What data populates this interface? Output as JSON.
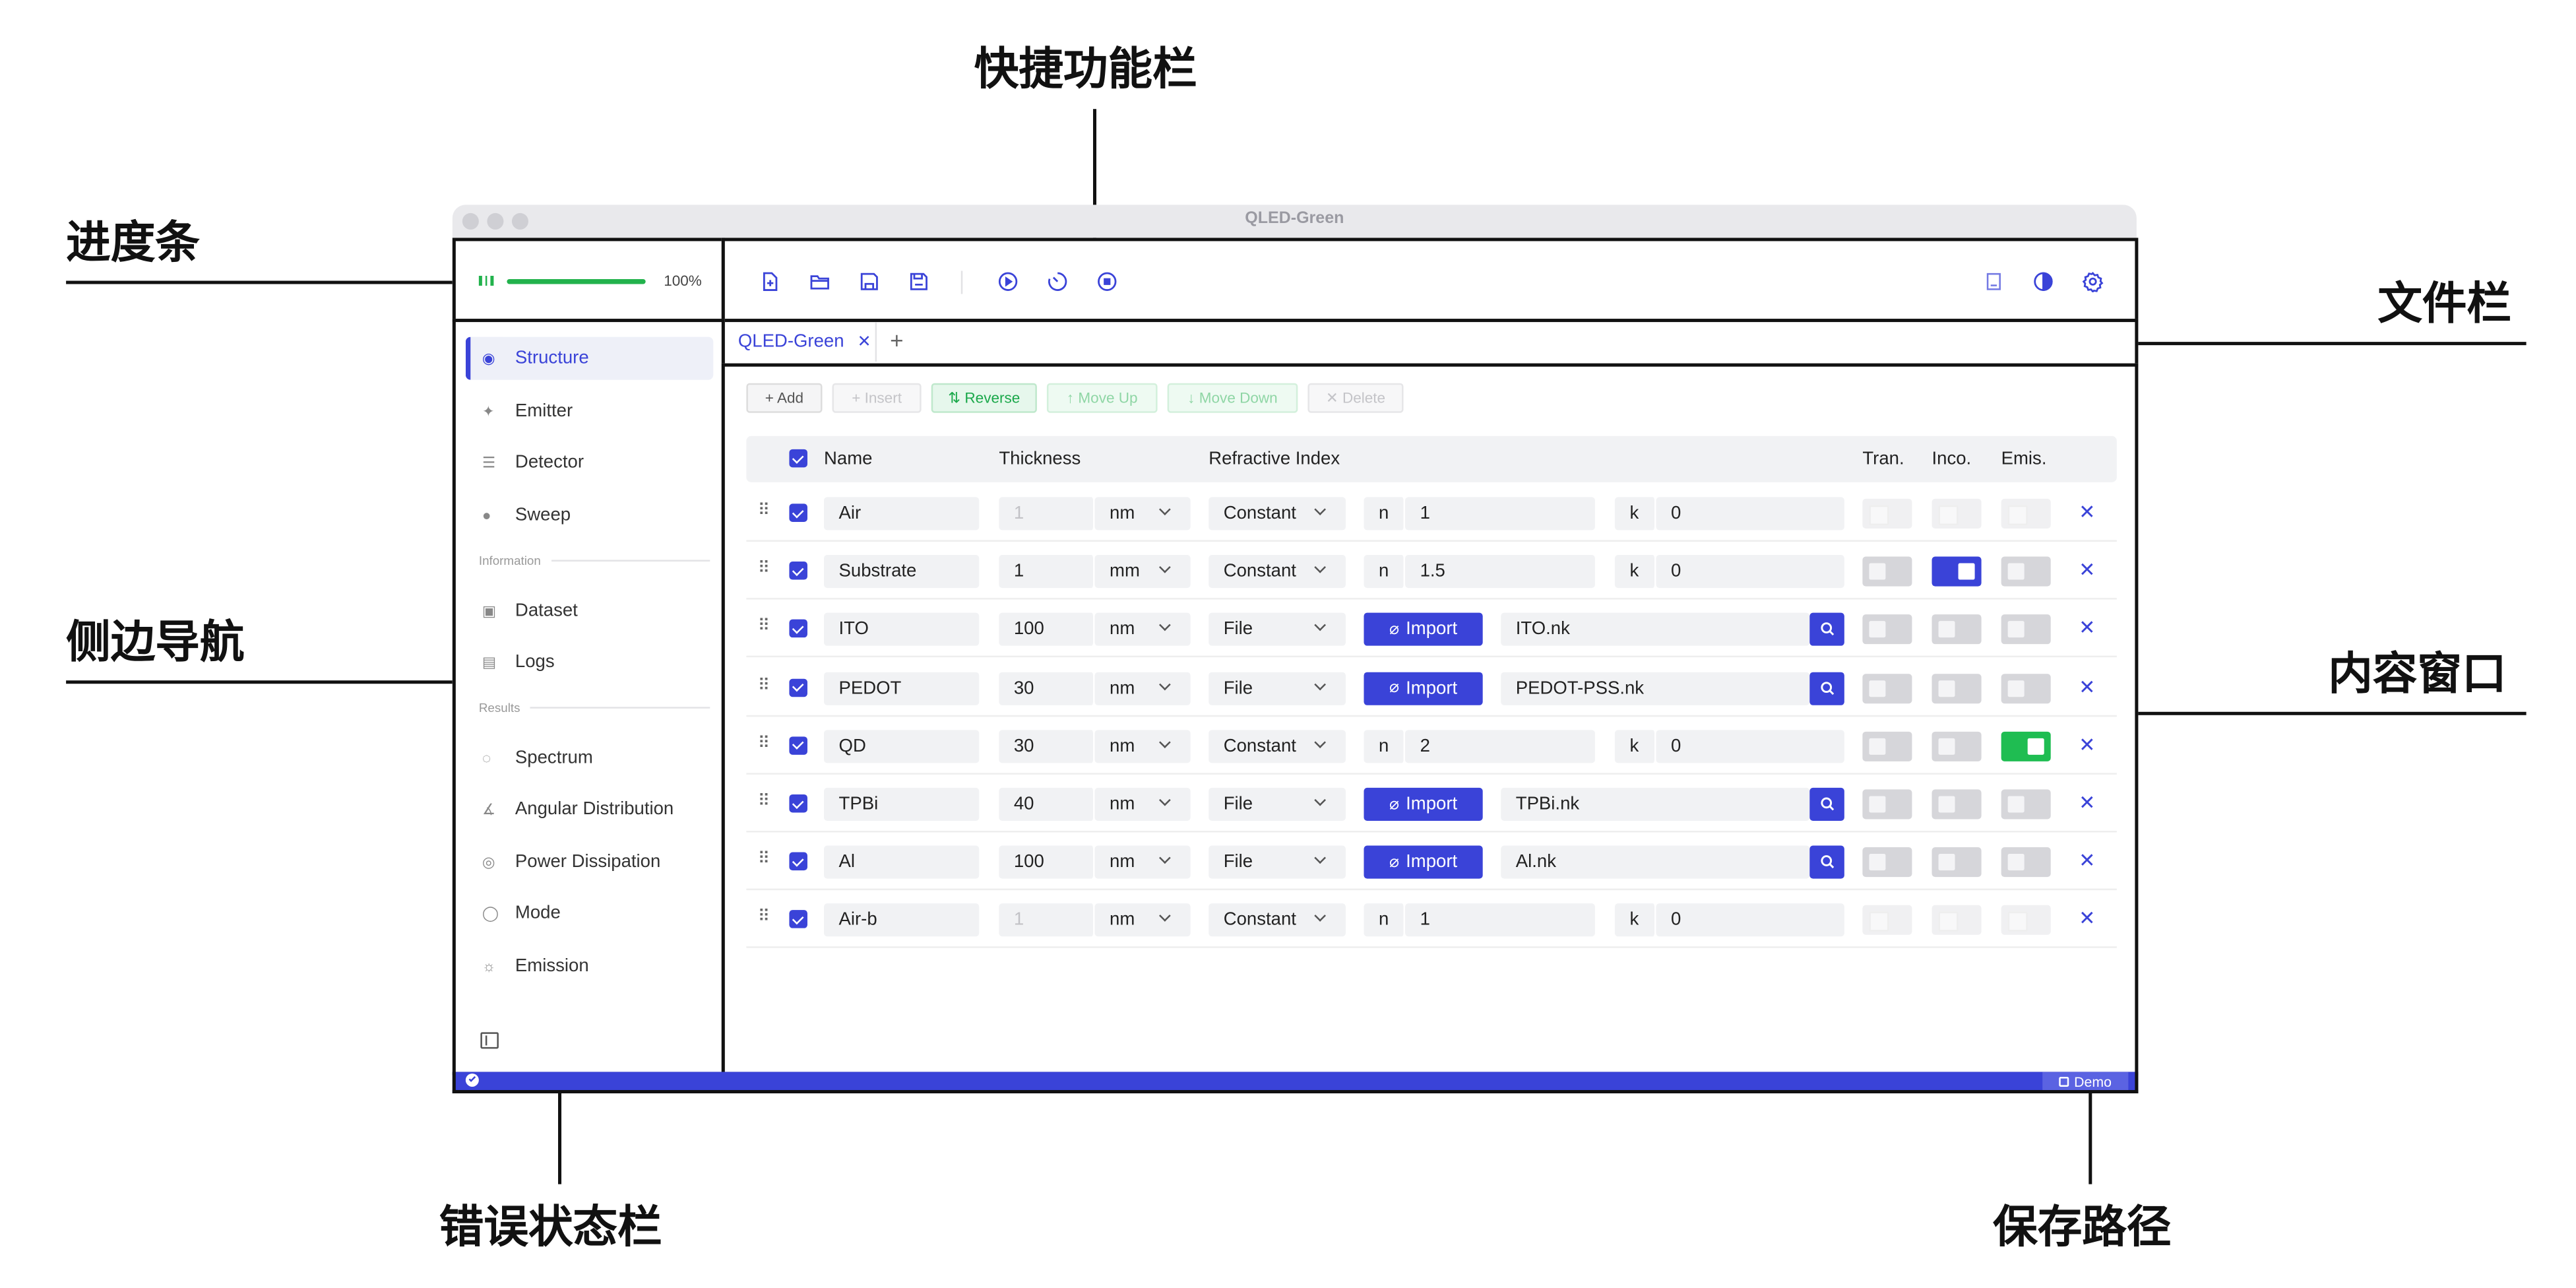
{
  "callouts": {
    "quick_toolbar": "快捷功能栏",
    "progress": "进度条",
    "file_bar": "文件栏",
    "sidebar": "侧边导航",
    "content": "内容窗口",
    "error_status": "错误状态栏",
    "save_path": "保存路径"
  },
  "window": {
    "title": "QLED-Green"
  },
  "progress": {
    "label": "100%",
    "value": 1.0,
    "color": "#22b24c"
  },
  "toolbar": {
    "left_icons": [
      "new-file-icon",
      "open-folder-icon",
      "save-icon",
      "save-as-icon"
    ],
    "run_icons": [
      "play-icon",
      "timer-icon",
      "stop-icon"
    ],
    "right_icons": [
      "book-icon",
      "theme-icon",
      "settings-icon"
    ]
  },
  "tabs": [
    {
      "label": "QLED-Green",
      "close": "✕"
    }
  ],
  "tab_add": "+",
  "sidebar": {
    "items": [
      {
        "label": "Structure",
        "icon": "database-icon",
        "active": true
      },
      {
        "label": "Emitter",
        "icon": "sparkle-icon"
      },
      {
        "label": "Detector",
        "icon": "sliders-icon"
      },
      {
        "label": "Sweep",
        "icon": "sweep-icon"
      }
    ],
    "information_label": "Information",
    "information": [
      {
        "label": "Dataset",
        "icon": "dataset-icon"
      },
      {
        "label": "Logs",
        "icon": "printer-icon"
      }
    ],
    "results_label": "Results",
    "results": [
      {
        "label": "Spectrum",
        "icon": "spectrum-icon"
      },
      {
        "label": "Angular Distribution",
        "icon": "angle-icon"
      },
      {
        "label": "Power Dissipation",
        "icon": "gauge-icon"
      },
      {
        "label": "Mode",
        "icon": "circle-icon"
      },
      {
        "label": "Emission",
        "icon": "sun-icon"
      }
    ],
    "collapse_icon": "collapse-sidebar-icon"
  },
  "actions": {
    "add": "+ Add",
    "insert": "+ Insert",
    "reverse": "⇅ Reverse",
    "move_up": "↑ Move Up",
    "move_down": "↓ Move Down",
    "delete": "✕ Delete"
  },
  "table": {
    "headers": {
      "name": "Name",
      "thickness": "Thickness",
      "ri": "Refractive Index",
      "tran": "Tran.",
      "inco": "Inco.",
      "emis": "Emis."
    },
    "import_label": "Import",
    "n_label": "n",
    "k_label": "k",
    "rows": [
      {
        "name": "Air",
        "thickness": "1",
        "unit": "nm",
        "ri_type": "Constant",
        "n": "1",
        "k": "0",
        "tran": "disabled",
        "inco": "disabled",
        "emis": "disabled",
        "dim": true
      },
      {
        "name": "Substrate",
        "thickness": "1",
        "unit": "mm",
        "ri_type": "Constant",
        "n": "1.5",
        "k": "0",
        "tran": "off",
        "inco": "on",
        "emis": "off"
      },
      {
        "name": "ITO",
        "thickness": "100",
        "unit": "nm",
        "ri_type": "File",
        "file": "ITO.nk",
        "tran": "off",
        "inco": "off",
        "emis": "off"
      },
      {
        "name": "PEDOT",
        "thickness": "30",
        "unit": "nm",
        "ri_type": "File",
        "file": "PEDOT-PSS.nk",
        "tran": "off",
        "inco": "off",
        "emis": "off"
      },
      {
        "name": "QD",
        "thickness": "30",
        "unit": "nm",
        "ri_type": "Constant",
        "n": "2",
        "k": "0",
        "tran": "off",
        "inco": "off",
        "emis": "on-green"
      },
      {
        "name": "TPBi",
        "thickness": "40",
        "unit": "nm",
        "ri_type": "File",
        "file": "TPBi.nk",
        "tran": "off",
        "inco": "off",
        "emis": "off"
      },
      {
        "name": "Al",
        "thickness": "100",
        "unit": "nm",
        "ri_type": "File",
        "file": "Al.nk",
        "tran": "off",
        "inco": "off",
        "emis": "off"
      },
      {
        "name": "Air-b",
        "thickness": "1",
        "unit": "nm",
        "ri_type": "Constant",
        "n": "1",
        "k": "0",
        "tran": "disabled",
        "inco": "disabled",
        "emis": "disabled",
        "dim": true
      }
    ]
  },
  "statusbar": {
    "save_label": "Demo",
    "accent": "#3a43d8"
  }
}
